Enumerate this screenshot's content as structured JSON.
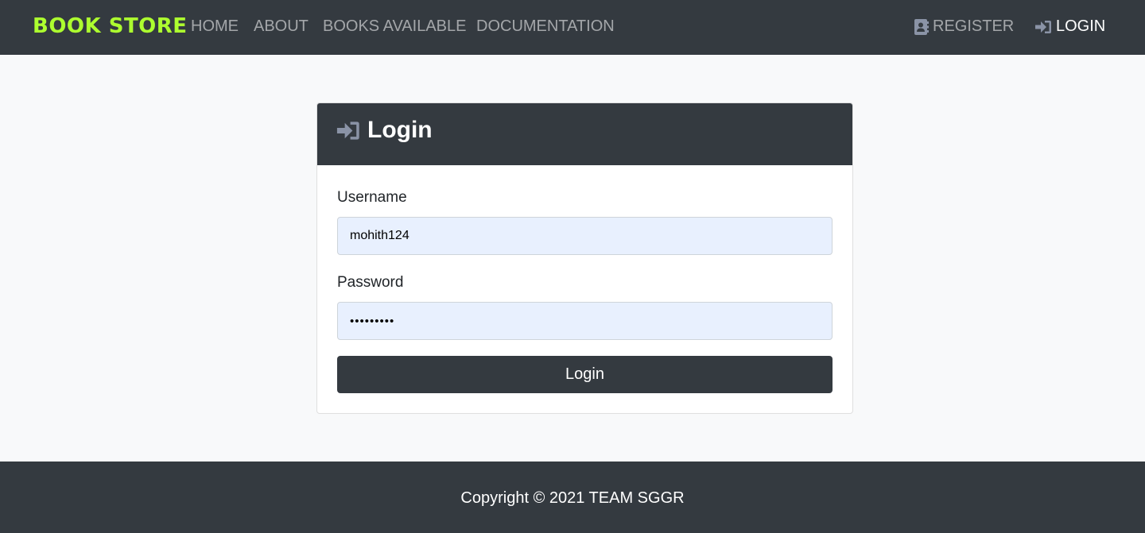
{
  "navbar": {
    "brand": "BOOK STORE",
    "links": [
      {
        "label": "HOME"
      },
      {
        "label": "ABOUT"
      },
      {
        "label": "BOOKS AVAILABLE"
      },
      {
        "label": "DOCUMENTATION"
      }
    ],
    "register": {
      "label": "REGISTER",
      "icon": "address-book-icon"
    },
    "login": {
      "label": "LOGIN",
      "icon": "sign-in-icon"
    }
  },
  "login_card": {
    "title": "Login",
    "title_icon": "sign-in-icon",
    "username_label": "Username",
    "username_value": "mohith124",
    "password_label": "Password",
    "password_value": "•••••••••",
    "submit_label": "Login"
  },
  "footer": {
    "copyright": "Copyright © 2021 TEAM SGGR"
  },
  "colors": {
    "dark": "#343a40",
    "brand": "#adff2f",
    "page_bg": "#f8f9fa",
    "input_bg": "#e8f0fe",
    "icon_muted": "#8a93a6"
  }
}
